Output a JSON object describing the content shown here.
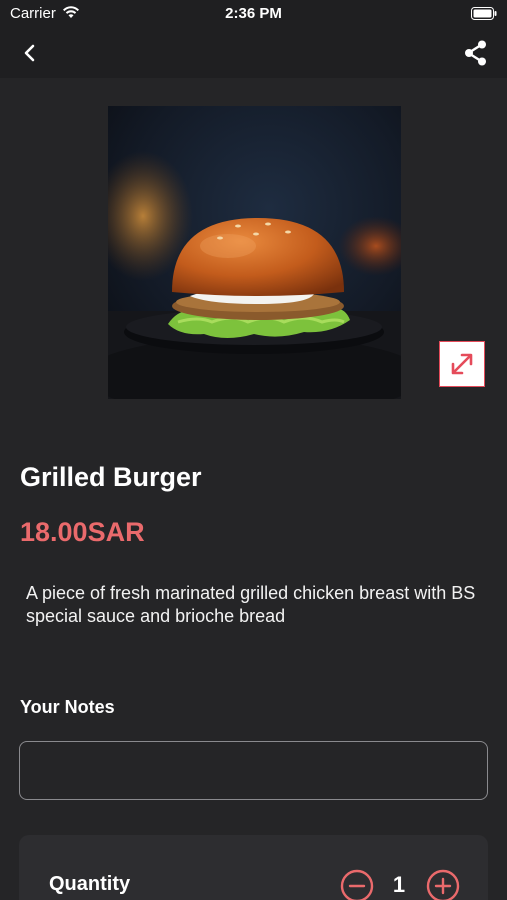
{
  "status_bar": {
    "carrier": "Carrier",
    "time": "2:36 PM",
    "icons": [
      "wifi-icon",
      "battery-icon"
    ]
  },
  "nav": {
    "back_icon": "chevron-left-icon",
    "share_icon": "share-icon"
  },
  "product": {
    "image_icon": "burger-photo",
    "expand_icon": "expand-arrows-icon",
    "title": "Grilled Burger",
    "price": "18.00SAR",
    "description": "A piece of fresh marinated grilled chicken breast with BS special sauce and brioche bread"
  },
  "notes": {
    "label": "Your Notes",
    "value": "",
    "placeholder": ""
  },
  "quantity": {
    "label": "Quantity",
    "value": "1",
    "minus_icon": "minus-circle-icon",
    "plus_icon": "plus-circle-icon"
  },
  "colors": {
    "background": "#252527",
    "accent": "#ea6a6c",
    "expand_border": "#e54b5a",
    "card": "#2d2d30"
  }
}
